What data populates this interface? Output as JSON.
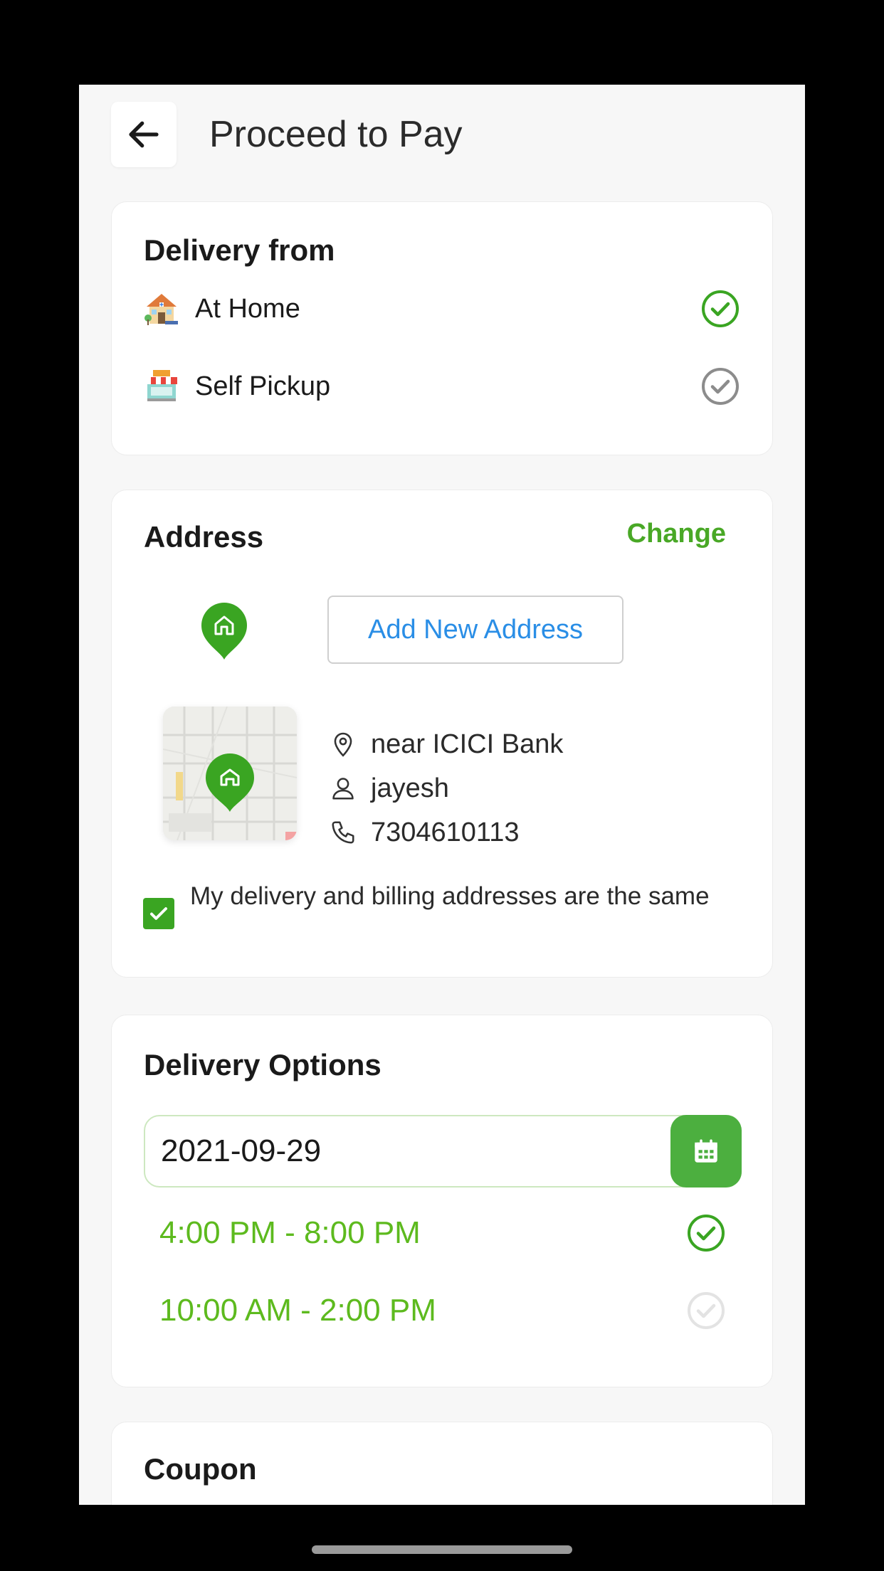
{
  "header": {
    "title": "Proceed to Pay",
    "back_icon": "arrow-left-icon"
  },
  "delivery_from": {
    "title": "Delivery from",
    "options": [
      {
        "label": "At Home",
        "icon": "house-emoji",
        "selected": true
      },
      {
        "label": "Self Pickup",
        "icon": "store-emoji",
        "selected": false
      }
    ]
  },
  "address": {
    "title": "Address",
    "change_label": "Change",
    "add_new_label": "Add New Address",
    "location": "near ICICI Bank",
    "name": "jayesh",
    "phone": "7304610113",
    "same_billing_label": "My delivery and billing addresses are the same",
    "same_billing_checked": true
  },
  "delivery_options": {
    "title": "Delivery Options",
    "date": "2021-09-29",
    "slots": [
      {
        "label": "4:00 PM - 8:00 PM",
        "selected": true
      },
      {
        "label": "10:00 AM - 2:00 PM",
        "selected": false
      }
    ]
  },
  "coupon": {
    "title": "Coupon"
  },
  "colors": {
    "accent_green": "#49a826",
    "slot_green": "#5dba1e",
    "link_blue": "#2a8ee6",
    "background": "#f7f7f7"
  }
}
